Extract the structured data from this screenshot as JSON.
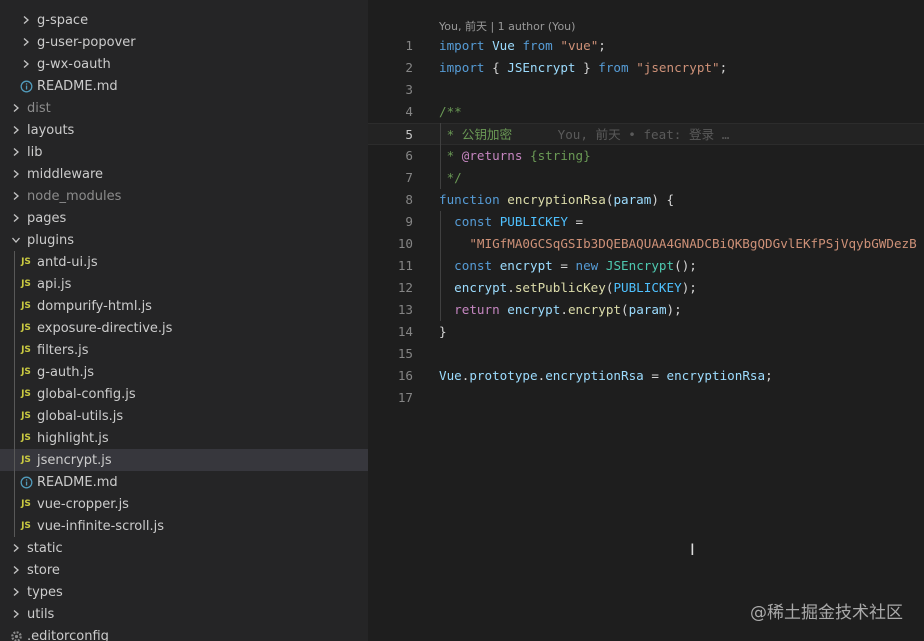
{
  "explorer": {
    "items": [
      {
        "label": "g-space",
        "type": "folder",
        "level": 1
      },
      {
        "label": "g-user-popover",
        "type": "folder",
        "level": 1
      },
      {
        "label": "g-wx-oauth",
        "type": "folder",
        "level": 1
      },
      {
        "label": "README.md",
        "type": "info",
        "level": 1
      },
      {
        "label": "dist",
        "type": "folder",
        "level": 0,
        "dim": true
      },
      {
        "label": "layouts",
        "type": "folder",
        "level": 0
      },
      {
        "label": "lib",
        "type": "folder",
        "level": 0
      },
      {
        "label": "middleware",
        "type": "folder",
        "level": 0
      },
      {
        "label": "node_modules",
        "type": "folder",
        "level": 0,
        "dim": true
      },
      {
        "label": "pages",
        "type": "folder",
        "level": 0
      },
      {
        "label": "plugins",
        "type": "folder-open",
        "level": 0
      },
      {
        "label": "antd-ui.js",
        "type": "js",
        "level": 1
      },
      {
        "label": "api.js",
        "type": "js",
        "level": 1
      },
      {
        "label": "dompurify-html.js",
        "type": "js",
        "level": 1
      },
      {
        "label": "exposure-directive.js",
        "type": "js",
        "level": 1
      },
      {
        "label": "filters.js",
        "type": "js",
        "level": 1
      },
      {
        "label": "g-auth.js",
        "type": "js",
        "level": 1
      },
      {
        "label": "global-config.js",
        "type": "js",
        "level": 1
      },
      {
        "label": "global-utils.js",
        "type": "js",
        "level": 1
      },
      {
        "label": "highlight.js",
        "type": "js",
        "level": 1
      },
      {
        "label": "jsencrypt.js",
        "type": "js",
        "level": 1,
        "selected": true
      },
      {
        "label": "README.md",
        "type": "info",
        "level": 1
      },
      {
        "label": "vue-cropper.js",
        "type": "js",
        "level": 1
      },
      {
        "label": "vue-infinite-scroll.js",
        "type": "js",
        "level": 1
      },
      {
        "label": "static",
        "type": "folder",
        "level": 0
      },
      {
        "label": "store",
        "type": "folder",
        "level": 0
      },
      {
        "label": "types",
        "type": "folder",
        "level": 0
      },
      {
        "label": "utils",
        "type": "folder",
        "level": 0
      },
      {
        "label": ".editorconfig",
        "type": "gear",
        "level": 0
      }
    ],
    "js_badge": "JS"
  },
  "editor": {
    "codelens": "You, 前天 | 1 author (You)",
    "active_line": 5,
    "lines": [
      {
        "n": "1",
        "tokens": [
          [
            "kw",
            "import"
          ],
          [
            "pl",
            " "
          ],
          [
            "var",
            "Vue"
          ],
          [
            "pl",
            " "
          ],
          [
            "kw",
            "from"
          ],
          [
            "pl",
            " "
          ],
          [
            "str",
            "\"vue\""
          ],
          [
            "pl",
            ";"
          ]
        ]
      },
      {
        "n": "2",
        "tokens": [
          [
            "kw",
            "import"
          ],
          [
            "pl",
            " { "
          ],
          [
            "var",
            "JSEncrypt"
          ],
          [
            "pl",
            " } "
          ],
          [
            "kw",
            "from"
          ],
          [
            "pl",
            " "
          ],
          [
            "str",
            "\"jsencrypt\""
          ],
          [
            "pl",
            ";"
          ]
        ]
      },
      {
        "n": "3",
        "tokens": []
      },
      {
        "n": "4",
        "tokens": [
          [
            "cm",
            "/**"
          ]
        ]
      },
      {
        "n": "5",
        "tokens": [
          [
            "cm",
            " * 公钥加密"
          ],
          [
            "ghost",
            "      You, 前天 • feat: 登录 …"
          ]
        ]
      },
      {
        "n": "6",
        "tokens": [
          [
            "cm",
            " * "
          ],
          [
            "ctl",
            "@returns"
          ],
          [
            "cm",
            " {string}"
          ]
        ]
      },
      {
        "n": "7",
        "tokens": [
          [
            "cm",
            " */"
          ]
        ]
      },
      {
        "n": "8",
        "tokens": [
          [
            "kw",
            "function"
          ],
          [
            "pl",
            " "
          ],
          [
            "fn",
            "encryptionRsa"
          ],
          [
            "pl",
            "("
          ],
          [
            "var",
            "param"
          ],
          [
            "pl",
            ") {"
          ]
        ]
      },
      {
        "n": "9",
        "tokens": [
          [
            "pl",
            "  "
          ],
          [
            "kw",
            "const"
          ],
          [
            "pl",
            " "
          ],
          [
            "cst",
            "PUBLICKEY"
          ],
          [
            "pl",
            " ="
          ]
        ]
      },
      {
        "n": "10",
        "tokens": [
          [
            "pl",
            "    "
          ],
          [
            "str",
            "\"MIGfMA0GCSqGSIb3DQEBAQUAA4GNADCBiQKBgQDGvlEKfPSjVqybGWDezB"
          ]
        ]
      },
      {
        "n": "11",
        "tokens": [
          [
            "pl",
            "  "
          ],
          [
            "kw",
            "const"
          ],
          [
            "pl",
            " "
          ],
          [
            "var",
            "encrypt"
          ],
          [
            "pl",
            " = "
          ],
          [
            "kw",
            "new"
          ],
          [
            "pl",
            " "
          ],
          [
            "cls",
            "JSEncrypt"
          ],
          [
            "pl",
            "();"
          ]
        ]
      },
      {
        "n": "12",
        "tokens": [
          [
            "pl",
            "  "
          ],
          [
            "var",
            "encrypt"
          ],
          [
            "pl",
            "."
          ],
          [
            "fn",
            "setPublicKey"
          ],
          [
            "pl",
            "("
          ],
          [
            "cst",
            "PUBLICKEY"
          ],
          [
            "pl",
            ");"
          ]
        ]
      },
      {
        "n": "13",
        "tokens": [
          [
            "pl",
            "  "
          ],
          [
            "ctl",
            "return"
          ],
          [
            "pl",
            " "
          ],
          [
            "var",
            "encrypt"
          ],
          [
            "pl",
            "."
          ],
          [
            "fn",
            "encrypt"
          ],
          [
            "pl",
            "("
          ],
          [
            "var",
            "param"
          ],
          [
            "pl",
            ");"
          ]
        ]
      },
      {
        "n": "14",
        "tokens": [
          [
            "pl",
            "}"
          ]
        ]
      },
      {
        "n": "15",
        "tokens": []
      },
      {
        "n": "16",
        "tokens": [
          [
            "var",
            "Vue"
          ],
          [
            "pl",
            "."
          ],
          [
            "var",
            "prototype"
          ],
          [
            "pl",
            "."
          ],
          [
            "var",
            "encryptionRsa"
          ],
          [
            "pl",
            " = "
          ],
          [
            "var",
            "encryptionRsa"
          ],
          [
            "pl",
            ";"
          ]
        ]
      },
      {
        "n": "17",
        "tokens": []
      }
    ]
  },
  "watermark": "@稀土掘金技术社区",
  "cursor_glyph": "I"
}
